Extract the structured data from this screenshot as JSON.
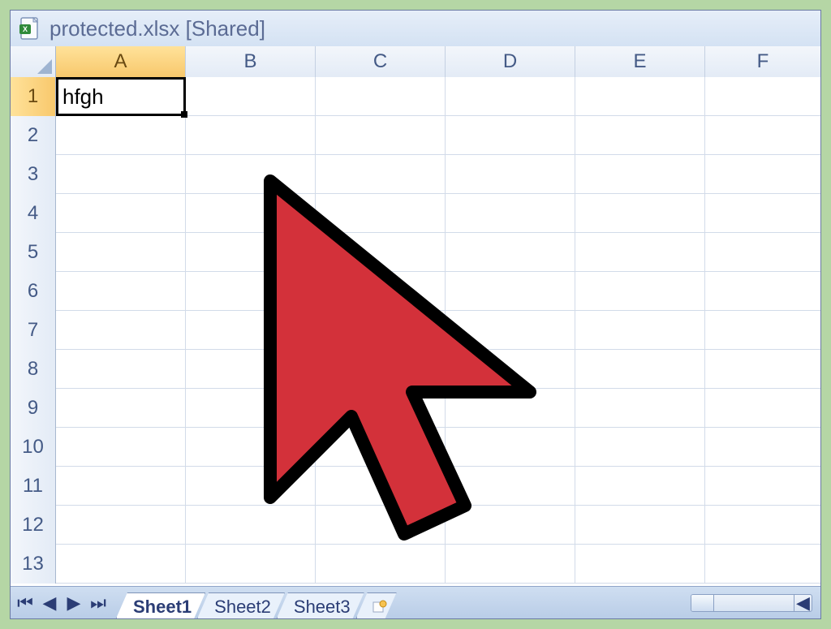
{
  "title": "protected.xlsx  [Shared]",
  "file_icon": "excel-file-icon",
  "columns": [
    "A",
    "B",
    "C",
    "D",
    "E",
    "F"
  ],
  "active_column_index": 0,
  "rows": [
    "1",
    "2",
    "3",
    "4",
    "5",
    "6",
    "7",
    "8",
    "9",
    "10",
    "11",
    "12",
    "13"
  ],
  "active_row_index": 0,
  "cells": {
    "A1": "hfgh"
  },
  "active_cell": "A1",
  "sheet_tabs": [
    "Sheet1",
    "Sheet2",
    "Sheet3"
  ],
  "active_sheet_index": 0,
  "nav_icons": [
    "⏮",
    "◀",
    "▶",
    "⏭"
  ],
  "new_sheet_icon": "✹",
  "scroll_arrow": "◀",
  "cursor_overlay": "large-red-cursor"
}
